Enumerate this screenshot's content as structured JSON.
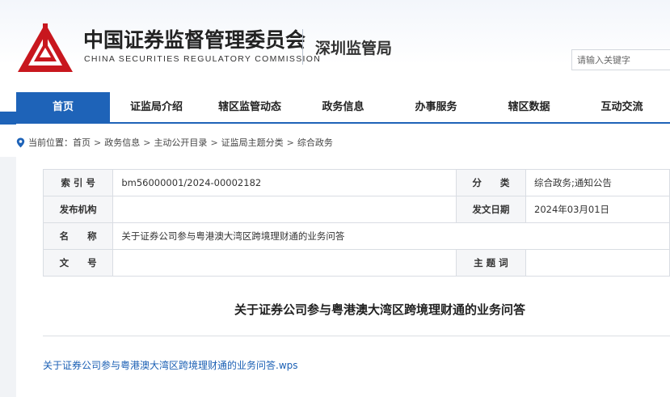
{
  "header": {
    "org_name_cn": "中国证券监督管理委员会",
    "org_name_en": "CHINA SECURITIES REGULATORY COMMISSION",
    "branch": "深圳监管局",
    "search_placeholder": "请输入关键字"
  },
  "colors": {
    "brand_red": "#c8171e",
    "nav_blue": "#1e63b8",
    "link_blue": "#1a5fb4"
  },
  "nav": {
    "items": [
      {
        "label": "首页",
        "active": true
      },
      {
        "label": "证监局介绍"
      },
      {
        "label": "辖区监管动态"
      },
      {
        "label": "政务信息"
      },
      {
        "label": "办事服务"
      },
      {
        "label": "辖区数据"
      },
      {
        "label": "互动交流"
      }
    ]
  },
  "breadcrumb": {
    "prefix": "当前位置：",
    "items": [
      "首页",
      "政务信息",
      "主动公开目录",
      "证监局主题分类",
      "综合政务"
    ],
    "separator": ">"
  },
  "meta": {
    "index_label": "索 引 号",
    "index_value": "bm56000001/2024-00002182",
    "category_label": "分　　类",
    "category_value": "综合政务;通知公告",
    "publisher_label": "发布机构",
    "publisher_value": "",
    "date_label": "发文日期",
    "date_value": "2024年03月01日",
    "name_label": "名　　称",
    "name_value": "关于证券公司参与粤港澳大湾区跨境理财通的业务问答",
    "docno_label": "文　　号",
    "docno_value": "",
    "keywords_label": "主 题 词",
    "keywords_value": ""
  },
  "document": {
    "title": "关于证券公司参与粤港澳大湾区跨境理财通的业务问答",
    "attachment": "关于证券公司参与粤港澳大湾区跨境理财通的业务问答.wps"
  }
}
